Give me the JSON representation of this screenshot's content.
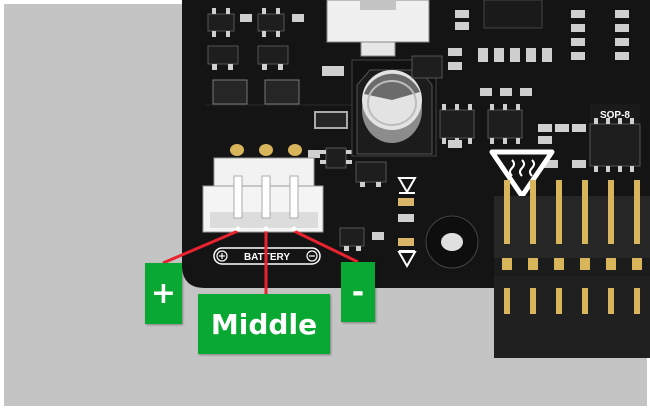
{
  "colors": {
    "background": "#c4c4c4",
    "pcb": "#141414",
    "callout_fill": "#08a832",
    "leader_line": "#e8232f",
    "connector": "#f2f2f2",
    "header_pins": "#d8b45a"
  },
  "pcb_silkscreen": {
    "connector_label": "BATTERY",
    "chip_label": "SOP-8"
  },
  "callouts": {
    "plus": "+",
    "middle": "Middle",
    "minus": "-"
  },
  "icons": [
    "pcb-board",
    "battery-connector",
    "electrolytic-capacitor",
    "pin-header",
    "heat-warning-icon",
    "mounting-hole",
    "led-marker-icon"
  ]
}
